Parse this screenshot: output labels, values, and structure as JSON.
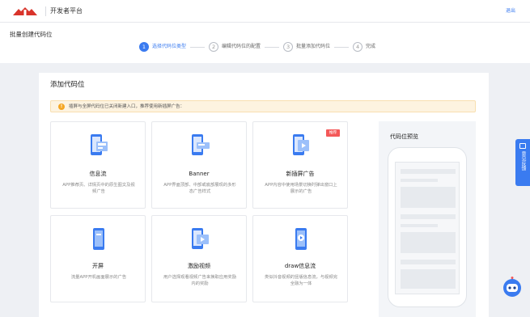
{
  "topbar": {
    "platform_name": "开发者平台",
    "logout_label": "退出"
  },
  "header": {
    "page_title": "批量创建代码位"
  },
  "steps": [
    {
      "num": "1",
      "label": "选择代码位类型"
    },
    {
      "num": "2",
      "label": "编辑代码位的配置"
    },
    {
      "num": "3",
      "label": "批量添加代码位"
    },
    {
      "num": "4",
      "label": "完成"
    }
  ],
  "main": {
    "section_title": "添加代码位",
    "notice_text": "插屏与全屏代码位已关闭新建入口，推荐使用新插屏广告：",
    "ad_types": [
      {
        "name": "信息流",
        "desc": "APP推荐页、详情页中的原生图文及视频广告",
        "icon": "feed-phone-icon"
      },
      {
        "name": "Banner",
        "desc": "APP界面顶部、中部或底部展现的多形态广告样式",
        "icon": "banner-phone-icon"
      },
      {
        "name": "新插屏广告",
        "desc": "APP内容中使用场景切换时弹出窗口上展示的广告",
        "icon": "interstitial-phone-icon",
        "badge": "推荐"
      },
      {
        "name": "开屏",
        "desc": "流量APP开机画面展示的广告",
        "icon": "splash-phone-icon"
      },
      {
        "name": "激励视频",
        "desc": "用户选择观看视频广告来换取应用奖励内的奖励",
        "icon": "reward-video-phone-icon"
      },
      {
        "name": "draw信息流",
        "desc": "类似抖音视频的竖版信息流，与视频完全融为一体",
        "icon": "draw-feed-phone-icon"
      }
    ]
  },
  "preview": {
    "title": "代码位预览"
  },
  "feedback": {
    "label": "意见反馈"
  },
  "colors": {
    "accent": "#3a7bf0",
    "badge": "#f45858",
    "notice_bg": "#fdf3e0",
    "logo": "#d9342b"
  }
}
